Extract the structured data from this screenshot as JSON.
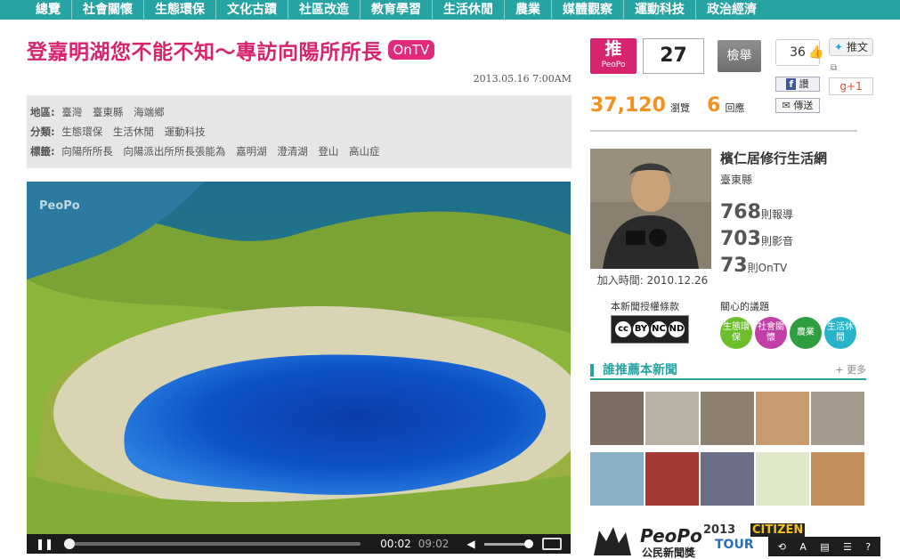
{
  "nav": {
    "items": [
      "總覽",
      "社會關懷",
      "生態環保",
      "文化古蹟",
      "社區改造",
      "教育學習",
      "生活休閒",
      "農業",
      "媒體觀察",
      "運動科技",
      "政治經濟"
    ]
  },
  "article": {
    "title": "登嘉明湖您不能不知～專訪向陽所所長",
    "badge": "OnTV",
    "date": "2013.05.16 7:00AM",
    "meta": {
      "region_label": "地區:",
      "regions": [
        "臺灣",
        "臺東縣",
        "海端鄉"
      ],
      "category_label": "分類:",
      "categories": [
        "生態環保",
        "生活休閒",
        "運動科技"
      ],
      "tag_label": "標籤:",
      "tags": [
        "向陽所所長",
        "向陽派出所所長張能為",
        "嘉明湖",
        "澄清湖",
        "登山",
        "高山症"
      ]
    }
  },
  "video": {
    "watermark": "PeoPo",
    "current_time": "00:02",
    "total_time": "09:02",
    "progress": 0.0037,
    "volume": 1.0
  },
  "actions": {
    "push_label": "推",
    "push_sub": "PeoPo",
    "push_count": "27",
    "report_label": "檢舉",
    "fb_like_count": "36",
    "tweet_label": "推文",
    "fb_share_label": "讚",
    "gplus_label": "+1",
    "forward_label": "傳送"
  },
  "stats": {
    "views": "37,120",
    "views_unit": "瀏覽",
    "replies": "6",
    "replies_unit": "回應"
  },
  "author": {
    "name": "檳仁居修行生活網",
    "location": "臺東縣",
    "reports": "768",
    "reports_unit": "則報導",
    "videos": "703",
    "videos_unit": "則影音",
    "ontv": "73",
    "ontv_unit": "則OnTV",
    "join_date": "加入時間: 2010.12.26"
  },
  "license": {
    "label": "本新聞授權條款",
    "icons": [
      "cc",
      "BY",
      "NC",
      "ND"
    ]
  },
  "topics": {
    "label": "關心的議題",
    "items": [
      {
        "label": "生態環保",
        "color": "#6cbf2a"
      },
      {
        "label": "社會關懷",
        "color": "#c23fa7"
      },
      {
        "label": "農業",
        "color": "#2e9e3e"
      },
      {
        "label": "生活休閒",
        "color": "#28b5c9"
      }
    ]
  },
  "recommenders": {
    "title": "誰推薦本新聞",
    "more": "+ 更多",
    "count": 10
  },
  "banner": {
    "brand": "PeoPo",
    "subtitle": "公民新聞獎",
    "year": "2013",
    "citizen": "CITIZEN",
    "tour": "TOUR"
  },
  "colors": {
    "nav_bg": "#27a3a3",
    "title": "#d6246f",
    "views": "#f39020"
  }
}
